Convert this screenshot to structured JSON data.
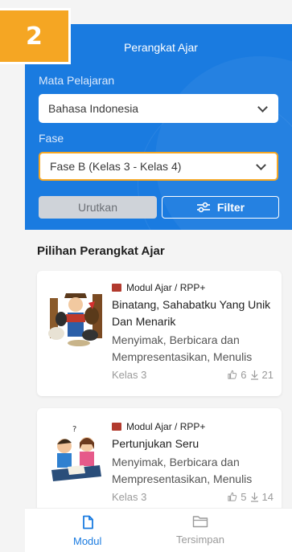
{
  "step_badge": "2",
  "header": {
    "title": "Perangkat Ajar",
    "subject_label": "Mata Pelajaran",
    "subject_value": "Bahasa Indonesia",
    "phase_label": "Fase",
    "phase_value": "Fase B (Kelas 3 - Kelas 4)",
    "sort_label": "Urutkan",
    "filter_label": "Filter"
  },
  "section_title": "Pilihan Perangkat Ajar",
  "cards": [
    {
      "category": "Modul Ajar / RPP+",
      "title": "Binatang, Sahabatku Yang Unik Dan Menarik",
      "desc": "Menyimak, Berbicara dan Mempresentasikan, Menulis",
      "grade": "Kelas 3",
      "likes": "6",
      "downloads": "21"
    },
    {
      "category": "Modul Ajar / RPP+",
      "title": "Pertunjukan Seru",
      "desc": "Menyimak, Berbicara dan Mempresentasikan, Menulis",
      "grade": "Kelas 3",
      "likes": "5",
      "downloads": "14"
    }
  ],
  "nav": {
    "modul": "Modul",
    "tersimpan": "Tersimpan"
  },
  "colors": {
    "primary": "#1a7be0",
    "accent": "#f5a623",
    "category_icon": "#b23a2e"
  }
}
